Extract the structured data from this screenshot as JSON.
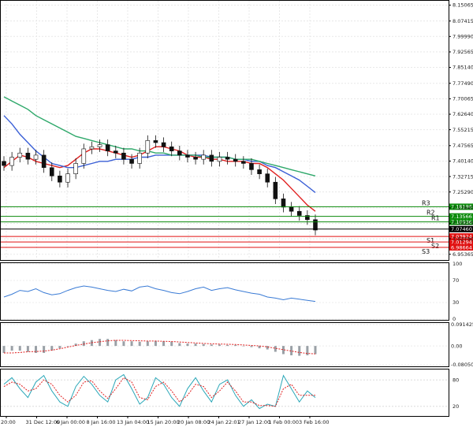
{
  "chart_data": [
    {
      "type": "candlestick",
      "panel": "price",
      "ylim": [
        6.93,
        8.16
      ],
      "price_scale_ticks": [
        "8.15065",
        "8.07415",
        "7.99990",
        "7.92565",
        "7.85140",
        "7.77490",
        "7.70065",
        "7.62640",
        "7.55215",
        "7.47565",
        "7.40140",
        "7.32715",
        "7.25290",
        "7.17640",
        "7.10215",
        "7.02790",
        "6.95365"
      ],
      "x_tick_labels": [
        "20:00",
        "31 Dec 12:00",
        "6 Jan 00:00",
        "8 Jan 16:00",
        "13 Jan 04:00",
        "15 Jan 20:00",
        "20 Jan 08:00",
        "24 Jan 22:01",
        "27 Jan 12:00",
        "1 Feb 00:00",
        "3 Feb 16:00"
      ],
      "moving_averages": [
        {
          "color": "#e02020",
          "values": [
            7.37,
            7.4,
            7.43,
            7.42,
            7.4,
            7.39,
            7.38,
            7.37,
            7.38,
            7.41,
            7.44,
            7.46,
            7.46,
            7.45,
            7.44,
            7.43,
            7.42,
            7.43,
            7.45,
            7.47,
            7.47,
            7.46,
            7.45,
            7.43,
            7.42,
            7.42,
            7.41,
            7.41,
            7.4,
            7.4,
            7.4,
            7.39,
            7.39,
            7.37,
            7.34,
            7.31,
            7.27,
            7.23,
            7.19,
            7.16
          ]
        },
        {
          "color": "#3a5fd6",
          "values": [
            7.62,
            7.58,
            7.53,
            7.49,
            7.45,
            7.42,
            7.39,
            7.38,
            7.37,
            7.37,
            7.38,
            7.39,
            7.4,
            7.4,
            7.41,
            7.41,
            7.41,
            7.42,
            7.42,
            7.43,
            7.43,
            7.43,
            7.43,
            7.43,
            7.43,
            7.43,
            7.42,
            7.42,
            7.42,
            7.41,
            7.41,
            7.4,
            7.4,
            7.38,
            7.37,
            7.35,
            7.33,
            7.31,
            7.28,
            7.25
          ]
        },
        {
          "color": "#2ea86a",
          "values": [
            7.71,
            7.69,
            7.67,
            7.65,
            7.62,
            7.6,
            7.58,
            7.56,
            7.54,
            7.52,
            7.51,
            7.5,
            7.49,
            7.48,
            7.47,
            7.46,
            7.46,
            7.45,
            7.45,
            7.44,
            7.44,
            7.43,
            7.43,
            7.43,
            7.43,
            7.42,
            7.42,
            7.42,
            7.42,
            7.41,
            7.41,
            7.41,
            7.4,
            7.39,
            7.38,
            7.37,
            7.36,
            7.35,
            7.34,
            7.33
          ]
        }
      ],
      "close": [
        7.38,
        7.42,
        7.44,
        7.41,
        7.43,
        7.37,
        7.33,
        7.3,
        7.34,
        7.39,
        7.46,
        7.47,
        7.48,
        7.45,
        7.44,
        7.41,
        7.39,
        7.44,
        7.5,
        7.49,
        7.47,
        7.45,
        7.43,
        7.42,
        7.41,
        7.43,
        7.4,
        7.42,
        7.41,
        7.4,
        7.39,
        7.36,
        7.34,
        7.3,
        7.22,
        7.18,
        7.16,
        7.14,
        7.12,
        7.07
      ],
      "levels": [
        {
          "label": "R3",
          "value": "7.18196",
          "color": "#0a8a0a"
        },
        {
          "label": "R2",
          "value": "7.13566",
          "color": "#0a8a0a"
        },
        {
          "label": "R1",
          "value": "7.10936",
          "color": "#0a8a0a"
        },
        {
          "label": "",
          "value": "7.07460",
          "color": "#000000"
        },
        {
          "label": "S1",
          "value": "7.03924",
          "color": "#e01010"
        },
        {
          "label": "S2",
          "value": "7.01294",
          "color": "#e01010"
        },
        {
          "label": "S3",
          "value": "6.98664",
          "color": "#e01010"
        }
      ]
    },
    {
      "type": "line",
      "panel": "rsi",
      "ylim": [
        0,
        100
      ],
      "y_tick_labels": [
        "100",
        "70",
        "30",
        "0"
      ],
      "series": [
        {
          "color": "#3a7bd5",
          "values": [
            40,
            45,
            52,
            50,
            55,
            48,
            44,
            46,
            52,
            57,
            60,
            58,
            55,
            52,
            50,
            54,
            51,
            58,
            60,
            55,
            52,
            48,
            46,
            50,
            55,
            58,
            52,
            55,
            57,
            53,
            50,
            47,
            45,
            40,
            38,
            35,
            38,
            36,
            34,
            32
          ]
        }
      ]
    },
    {
      "type": "histogram",
      "panel": "macd",
      "y_tick_labels": [
        "0.091425",
        "0.00",
        "-0.080506"
      ],
      "values": [
        -0.03,
        -0.02,
        -0.02,
        -0.025,
        -0.03,
        -0.03,
        -0.02,
        -0.01,
        0.0,
        0.01,
        0.02,
        0.025,
        0.03,
        0.03,
        0.025,
        0.02,
        0.02,
        0.018,
        0.02,
        0.022,
        0.02,
        0.018,
        0.012,
        0.01,
        0.01,
        0.008,
        0.006,
        0.006,
        0.004,
        0.004,
        0.0,
        -0.005,
        -0.01,
        -0.015,
        -0.025,
        -0.035,
        -0.04,
        -0.042,
        -0.04,
        -0.035
      ],
      "signal": [
        -0.03,
        -0.03,
        -0.028,
        -0.025,
        -0.024,
        -0.022,
        -0.018,
        -0.012,
        -0.005,
        0.002,
        0.008,
        0.014,
        0.018,
        0.022,
        0.024,
        0.024,
        0.023,
        0.022,
        0.021,
        0.021,
        0.02,
        0.019,
        0.017,
        0.015,
        0.013,
        0.011,
        0.009,
        0.008,
        0.007,
        0.006,
        0.004,
        0.002,
        0.0,
        -0.004,
        -0.01,
        -0.016,
        -0.022,
        -0.028,
        -0.032,
        -0.034
      ],
      "signal_color": "#e02020",
      "bar_color": "#9aa0a6"
    },
    {
      "type": "line",
      "panel": "stochastic",
      "ylim": [
        0,
        100
      ],
      "y_tick_labels": [
        "80",
        "20"
      ],
      "series": [
        {
          "color": "#2aa7b8",
          "values": [
            70,
            85,
            60,
            40,
            75,
            90,
            55,
            30,
            20,
            65,
            88,
            70,
            45,
            30,
            80,
            92,
            60,
            25,
            40,
            85,
            70,
            40,
            20,
            60,
            85,
            55,
            30,
            70,
            80,
            45,
            20,
            35,
            15,
            25,
            20,
            90,
            60,
            30,
            55,
            40
          ]
        },
        {
          "color": "#e02020",
          "values": [
            65,
            75,
            70,
            55,
            60,
            80,
            70,
            45,
            30,
            45,
            75,
            78,
            55,
            38,
            60,
            85,
            75,
            40,
            35,
            65,
            75,
            55,
            30,
            45,
            70,
            65,
            40,
            55,
            75,
            55,
            30,
            30,
            22,
            22,
            20,
            60,
            70,
            45,
            45,
            45
          ]
        }
      ]
    }
  ]
}
